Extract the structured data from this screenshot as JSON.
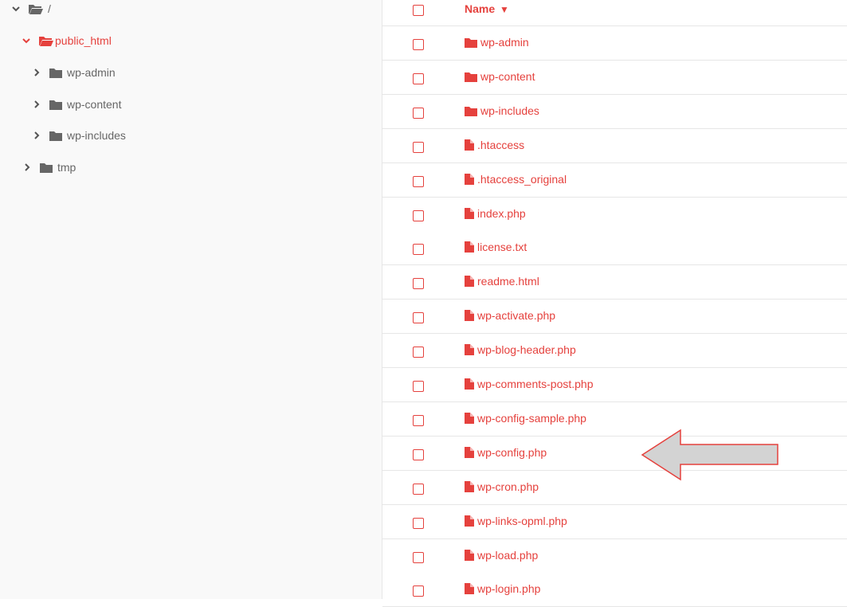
{
  "colors": {
    "accent": "#e5413d",
    "tree_text": "#666666",
    "arrow_fill": "#d3d3d3"
  },
  "tree": {
    "root": {
      "label": "/",
      "icon": "folder-open-icon"
    },
    "items": [
      {
        "label": "public_html",
        "icon": "folder-open-icon",
        "expanded": true,
        "active": true
      },
      {
        "label": "wp-admin",
        "icon": "folder-icon"
      },
      {
        "label": "wp-content",
        "icon": "folder-icon"
      },
      {
        "label": "wp-includes",
        "icon": "folder-icon"
      },
      {
        "label": "tmp",
        "icon": "folder-icon"
      }
    ]
  },
  "list": {
    "header": {
      "name_label": "Name",
      "sort_indicator": "▼"
    },
    "rows": [
      {
        "name": "wp-admin",
        "type": "folder"
      },
      {
        "name": "wp-content",
        "type": "folder"
      },
      {
        "name": "wp-includes",
        "type": "folder"
      },
      {
        "name": ".htaccess",
        "type": "file"
      },
      {
        "name": ".htaccess_original",
        "type": "file"
      },
      {
        "name": "index.php",
        "type": "file"
      },
      {
        "name": "license.txt",
        "type": "file"
      },
      {
        "name": "readme.html",
        "type": "file"
      },
      {
        "name": "wp-activate.php",
        "type": "file"
      },
      {
        "name": "wp-blog-header.php",
        "type": "file"
      },
      {
        "name": "wp-comments-post.php",
        "type": "file"
      },
      {
        "name": "wp-config-sample.php",
        "type": "file"
      },
      {
        "name": "wp-config.php",
        "type": "file"
      },
      {
        "name": "wp-cron.php",
        "type": "file"
      },
      {
        "name": "wp-links-opml.php",
        "type": "file"
      },
      {
        "name": "wp-load.php",
        "type": "file"
      },
      {
        "name": "wp-login.php",
        "type": "file"
      }
    ]
  },
  "annotation": {
    "icon": "arrow-left-icon",
    "target": "wp-config.php"
  }
}
